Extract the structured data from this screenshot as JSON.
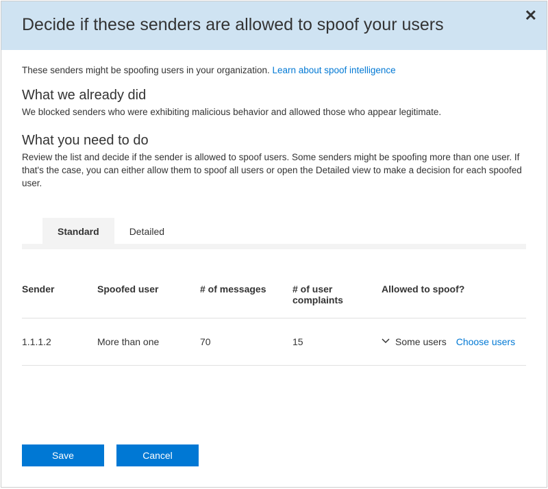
{
  "header": {
    "title": "Decide if these senders are allowed to spoof your users"
  },
  "intro": {
    "text": "These senders might be spoofing users in your organization. ",
    "link_text": "Learn about spoof intelligence"
  },
  "section1": {
    "heading": "What we already did",
    "text": "We blocked senders who were exhibiting malicious behavior and allowed those who appear legitimate."
  },
  "section2": {
    "heading": "What you need to do",
    "text": "Review the list and decide if the sender is allowed to spoof users. Some senders might be spoofing more than one user. If that's the case, you can either allow them to spoof all users or open the Detailed view to make a decision for each spoofed user."
  },
  "tabs": {
    "standard": "Standard",
    "detailed": "Detailed"
  },
  "table": {
    "headers": {
      "sender": "Sender",
      "spoofed_user": "Spoofed user",
      "messages": "# of messages",
      "complaints": "# of user complaints",
      "allowed": "Allowed to spoof?"
    },
    "rows": [
      {
        "sender": "1.1.1.2",
        "spoofed_user": "More than one",
        "messages": "70",
        "complaints": "15",
        "allowed_text": "Some users",
        "choose_text": "Choose users"
      }
    ]
  },
  "buttons": {
    "save": "Save",
    "cancel": "Cancel"
  }
}
